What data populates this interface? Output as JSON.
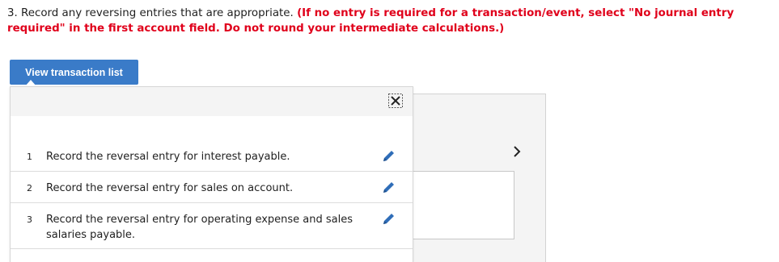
{
  "instructions": {
    "prefix": "3. Record any reversing entries that are appropriate. ",
    "requirement": "(If no entry is required for a transaction/event, select \"No journal entry required\" in the first account field. Do not round your intermediate calculations.)"
  },
  "toolbar": {
    "view_transaction_list_label": "View transaction list"
  },
  "transactions": [
    {
      "number": "1",
      "text": "Record the reversal entry for interest payable."
    },
    {
      "number": "2",
      "text": "Record the reversal entry for sales on account."
    },
    {
      "number": "3",
      "text": "Record the reversal entry for operating expense and sales salaries payable."
    }
  ],
  "icons": {
    "close": "close-icon",
    "edit": "pencil-icon",
    "next": "chevron-right-icon"
  },
  "colors": {
    "button": "#3a7bc8",
    "requirement_text": "#e0001b",
    "edit_icon": "#2f6db8"
  }
}
